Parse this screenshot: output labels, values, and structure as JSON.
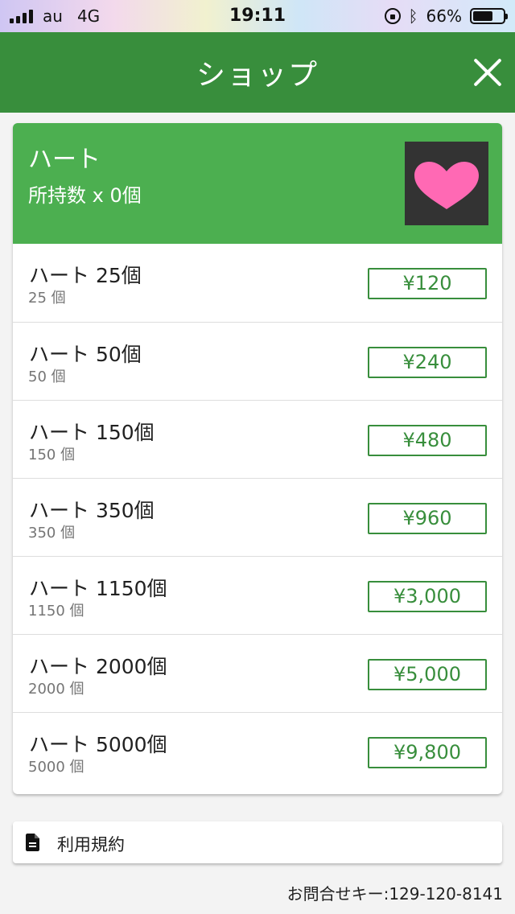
{
  "status_bar": {
    "carrier": "au",
    "network": "4G",
    "time": "19:11",
    "battery": "66%",
    "battery_level": 0.66,
    "icons": [
      "signal-icon",
      "lock-rotation-icon",
      "bluetooth-icon",
      "battery-icon"
    ]
  },
  "header": {
    "title": "ショップ",
    "close_icon": "close-icon",
    "color": "#388e3c"
  },
  "product": {
    "title": "ハート",
    "owned": "所持数 x 0個",
    "image_icon": "heart-icon",
    "header_color": "#4caf50",
    "heart_color": "#ff69b4"
  },
  "items": [
    {
      "name": "ハート 25個",
      "sub": "25 個",
      "price": "¥120"
    },
    {
      "name": "ハート 50個",
      "sub": "50 個",
      "price": "¥240"
    },
    {
      "name": "ハート 150個",
      "sub": "150 個",
      "price": "¥480"
    },
    {
      "name": "ハート 350個",
      "sub": "350 個",
      "price": "¥960"
    },
    {
      "name": "ハート 1150個",
      "sub": "1150 個",
      "price": "¥3,000"
    },
    {
      "name": "ハート 2000個",
      "sub": "2000 個",
      "price": "¥5,000"
    },
    {
      "name": "ハート 5000個",
      "sub": "5000 個",
      "price": "¥9,800"
    }
  ],
  "terms": {
    "label": "利用規約",
    "icon": "document-icon"
  },
  "inquiry": "お問合せキー:129-120-8141"
}
